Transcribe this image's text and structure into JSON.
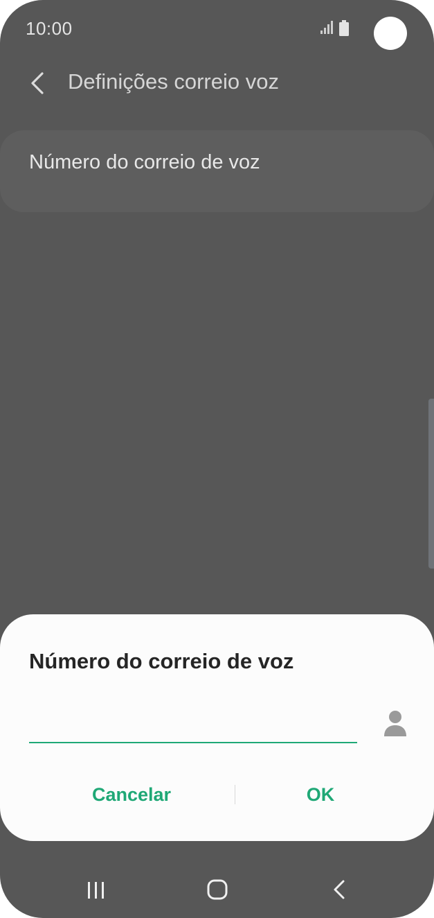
{
  "status_bar": {
    "time": "10:00",
    "icons": [
      "signal-icon",
      "battery-icon"
    ]
  },
  "header": {
    "title": "Definições correio voz",
    "back_icon": "chevron-left-icon"
  },
  "list": {
    "items": [
      {
        "label": "Número do correio de voz"
      }
    ]
  },
  "dialog": {
    "title": "Número do correio de voz",
    "input": {
      "value": "",
      "placeholder": ""
    },
    "contact_icon": "person-icon",
    "cancel_label": "Cancelar",
    "ok_label": "OK"
  },
  "nav_bar": {
    "icons": [
      "recent-apps-icon",
      "home-icon",
      "back-icon"
    ]
  },
  "colors": {
    "accent": "#1fa876",
    "scrim": "#575757",
    "dialog_bg": "#fcfcfc"
  }
}
